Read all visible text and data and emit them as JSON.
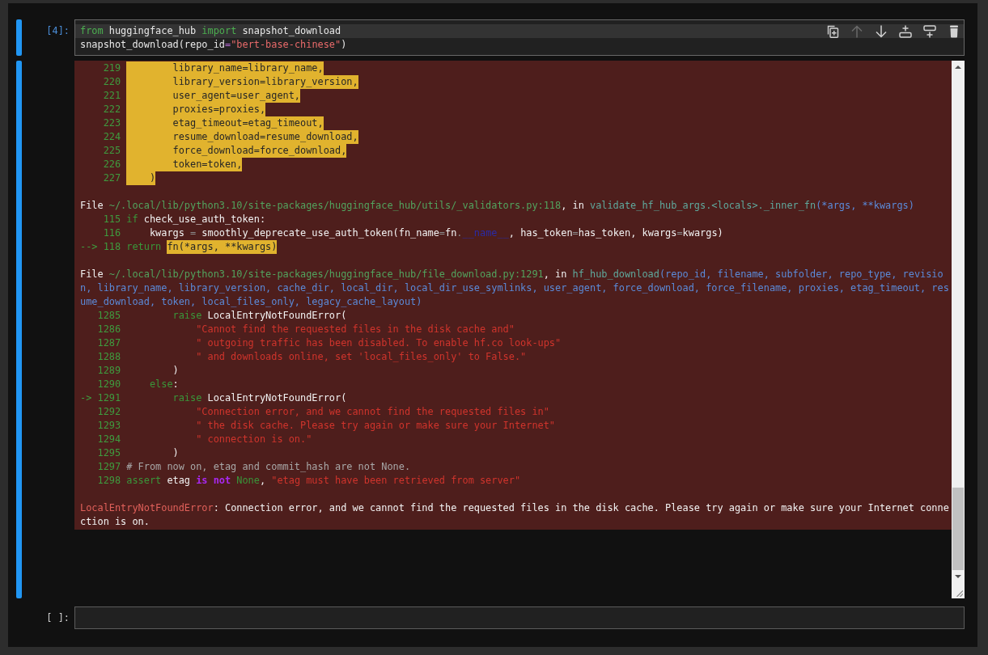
{
  "cells": [
    {
      "prompt": "[4]:",
      "selected": true,
      "source": [
        {
          "active": true,
          "tokens": [
            {
              "text": "from",
              "kind": "keyword"
            },
            {
              "text": " huggingface_hub ",
              "kind": "plain"
            },
            {
              "text": "import",
              "kind": "keyword"
            },
            {
              "text": " snapshot_download",
              "kind": "plain"
            }
          ]
        },
        {
          "active": false,
          "tokens": [
            {
              "text": "snapshot_download(repo_id",
              "kind": "plain"
            },
            {
              "text": "=",
              "kind": "operator"
            },
            {
              "text": "\"bert-base-chinese\"",
              "kind": "string"
            },
            {
              "text": ")",
              "kind": "plain"
            }
          ]
        }
      ],
      "toolbar": [
        {
          "kind": "duplicate",
          "disabled": false
        },
        {
          "kind": "move-up",
          "disabled": true
        },
        {
          "kind": "move-down",
          "disabled": false
        },
        {
          "kind": "insert-above",
          "disabled": false
        },
        {
          "kind": "insert-below",
          "disabled": false
        },
        {
          "kind": "delete",
          "disabled": false
        }
      ],
      "output": {
        "frames": [
          {
            "lines": [
              {
                "number": "219",
                "tokens": [
                  {
                    "text": "        library_name=library_name,",
                    "kind": "highlight"
                  }
                ]
              },
              {
                "number": "220",
                "tokens": [
                  {
                    "text": "        library_version=library_version,",
                    "kind": "highlight"
                  }
                ]
              },
              {
                "number": "221",
                "tokens": [
                  {
                    "text": "        user_agent=user_agent,",
                    "kind": "highlight"
                  }
                ]
              },
              {
                "number": "222",
                "tokens": [
                  {
                    "text": "        proxies=proxies,",
                    "kind": "highlight"
                  }
                ]
              },
              {
                "number": "223",
                "tokens": [
                  {
                    "text": "        etag_timeout=etag_timeout,",
                    "kind": "highlight"
                  }
                ]
              },
              {
                "number": "224",
                "tokens": [
                  {
                    "text": "        resume_download=resume_download,",
                    "kind": "highlight"
                  }
                ]
              },
              {
                "number": "225",
                "tokens": [
                  {
                    "text": "        force_download=force_download,",
                    "kind": "highlight"
                  }
                ]
              },
              {
                "number": "226",
                "tokens": [
                  {
                    "text": "        token=token,",
                    "kind": "highlight"
                  }
                ]
              },
              {
                "number": "227",
                "tokens": [
                  {
                    "text": "    )",
                    "kind": "highlight"
                  }
                ]
              }
            ]
          },
          {
            "header": [
              {
                "text": "File ",
                "kind": "plain"
              },
              {
                "text": "~/.local/lib/python3.10/site-packages/huggingface_hub/utils/_validators.py:118",
                "kind": "path"
              },
              {
                "text": ", in ",
                "kind": "plain"
              },
              {
                "text": "validate_hf_hub_args.<locals>._inner_fn",
                "kind": "function"
              },
              {
                "text": "(*args, **kwargs)",
                "kind": "args"
              }
            ],
            "lines": [
              {
                "number": "115",
                "tokens": [
                  {
                    "text": "if",
                    "kind": "keyword"
                  },
                  {
                    "text": " check_use_auth_token:",
                    "kind": "plain"
                  }
                ]
              },
              {
                "number": "116",
                "tokens": [
                  {
                    "text": "    kwargs ",
                    "kind": "plain"
                  },
                  {
                    "text": "=",
                    "kind": "operator"
                  },
                  {
                    "text": " smoothly_deprecate_use_auth_token(fn_name",
                    "kind": "plain"
                  },
                  {
                    "text": "=",
                    "kind": "operator"
                  },
                  {
                    "text": "fn",
                    "kind": "plain"
                  },
                  {
                    "text": ".",
                    "kind": "operator"
                  },
                  {
                    "text": "__name__",
                    "kind": "dunder"
                  },
                  {
                    "text": ", has_token",
                    "kind": "plain"
                  },
                  {
                    "text": "=",
                    "kind": "operator"
                  },
                  {
                    "text": "has_token, kwargs",
                    "kind": "plain"
                  },
                  {
                    "text": "=",
                    "kind": "operator"
                  },
                  {
                    "text": "kwargs)",
                    "kind": "plain"
                  }
                ]
              },
              {
                "marker": "-->",
                "number": "118",
                "tokens": [
                  {
                    "text": "return ",
                    "kind": "keyword"
                  },
                  {
                    "text": "fn(*args, **kwargs)",
                    "kind": "highlight"
                  }
                ]
              }
            ]
          },
          {
            "header": [
              {
                "text": "File ",
                "kind": "plain"
              },
              {
                "text": "~/.local/lib/python3.10/site-packages/huggingface_hub/file_download.py:1291",
                "kind": "path"
              },
              {
                "text": ", in ",
                "kind": "plain"
              },
              {
                "text": "hf_hub_download",
                "kind": "function"
              },
              {
                "text": "(repo_id, filename, subfolder, repo_type, revision, library_name, library_version, cache_dir, local_dir, local_dir_use_symlinks, user_agent, force_download, force_filename, proxies, etag_timeout, resume_download, token, local_files_only, legacy_cache_layout)",
                "kind": "args"
              }
            ],
            "lines": [
              {
                "number": "1285",
                "tokens": [
                  {
                    "text": "        raise",
                    "kind": "keyword"
                  },
                  {
                    "text": " LocalEntryNotFoundError(",
                    "kind": "plain"
                  }
                ]
              },
              {
                "number": "1286",
                "tokens": [
                  {
                    "text": "            \"Cannot find the requested files in the disk cache and\"",
                    "kind": "string"
                  }
                ]
              },
              {
                "number": "1287",
                "tokens": [
                  {
                    "text": "            \" outgoing traffic has been disabled. To enable hf.co look-ups\"",
                    "kind": "string"
                  }
                ]
              },
              {
                "number": "1288",
                "tokens": [
                  {
                    "text": "            \" and downloads online, set 'local_files_only' to False.\"",
                    "kind": "string"
                  }
                ]
              },
              {
                "number": "1289",
                "tokens": [
                  {
                    "text": "        )",
                    "kind": "plain"
                  }
                ]
              },
              {
                "number": "1290",
                "tokens": [
                  {
                    "text": "    else",
                    "kind": "keyword"
                  },
                  {
                    "text": ":",
                    "kind": "plain"
                  }
                ]
              },
              {
                "marker": "->",
                "number": "1291",
                "tokens": [
                  {
                    "text": "        raise",
                    "kind": "keyword"
                  },
                  {
                    "text": " LocalEntryNotFoundError(",
                    "kind": "plain"
                  }
                ]
              },
              {
                "number": "1292",
                "tokens": [
                  {
                    "text": "            \"Connection error, and we cannot find the requested files in\"",
                    "kind": "string"
                  }
                ]
              },
              {
                "number": "1293",
                "tokens": [
                  {
                    "text": "            \" the disk cache. Please try again or make sure your Internet\"",
                    "kind": "string"
                  }
                ]
              },
              {
                "number": "1294",
                "tokens": [
                  {
                    "text": "            \" connection is on.\"",
                    "kind": "string"
                  }
                ]
              },
              {
                "number": "1295",
                "tokens": [
                  {
                    "text": "        )",
                    "kind": "plain"
                  }
                ]
              },
              {
                "number": "1297",
                "tokens": [
                  {
                    "text": "# From now on, etag and commit_hash are not None.",
                    "kind": "comment"
                  }
                ]
              },
              {
                "number": "1298",
                "tokens": [
                  {
                    "text": "assert",
                    "kind": "keyword"
                  },
                  {
                    "text": " etag ",
                    "kind": "plain"
                  },
                  {
                    "text": "is not",
                    "kind": "operator-word"
                  },
                  {
                    "text": " None",
                    "kind": "keyword"
                  },
                  {
                    "text": ", ",
                    "kind": "plain"
                  },
                  {
                    "text": "\"etag must have been retrieved from server\"",
                    "kind": "string"
                  }
                ]
              }
            ]
          }
        ],
        "error": [
          {
            "text": "LocalEntryNotFoundError",
            "kind": "error-name"
          },
          {
            "text": ": Connection error, and we cannot find the requested files in the disk cache. Please try again or make sure your Internet connection is on.",
            "kind": "plain"
          }
        ]
      }
    },
    {
      "prompt": "[ ]:",
      "selected": false
    }
  ]
}
